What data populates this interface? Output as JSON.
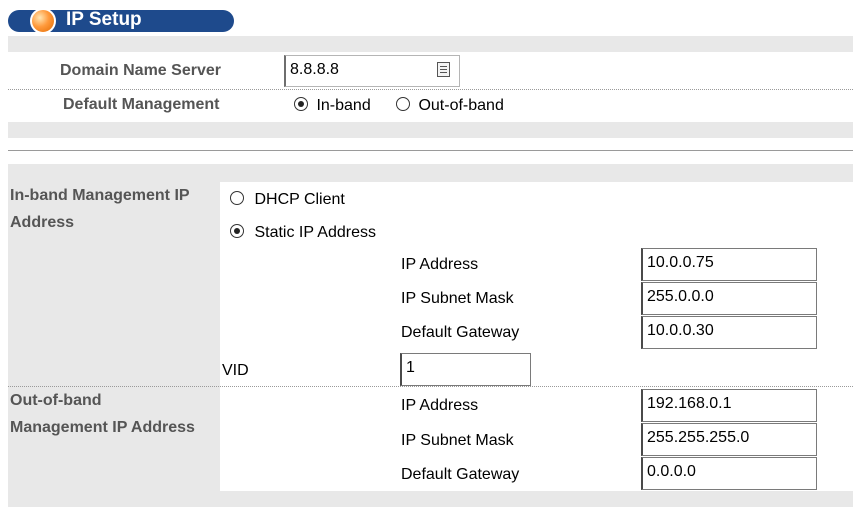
{
  "title": "IP Setup",
  "dns": {
    "label": "Domain Name Server",
    "value": "8.8.8.8",
    "picker_icon": "list-picker-icon"
  },
  "default_management": {
    "label": "Default Management",
    "options": [
      {
        "label": "In-band",
        "selected": true
      },
      {
        "label": "Out-of-band",
        "selected": false
      }
    ]
  },
  "inband": {
    "label_line1": "In-band Management IP",
    "label_line2": "Address",
    "dhcp_label": "DHCP Client",
    "dhcp_selected": false,
    "static_label": "Static IP Address",
    "static_selected": true,
    "ip_label": "IP Address",
    "ip_value": "10.0.0.75",
    "mask_label": "IP Subnet Mask",
    "mask_value": "255.0.0.0",
    "gw_label": "Default Gateway",
    "gw_value": "10.0.0.30",
    "vid_label": "VID",
    "vid_value": "1"
  },
  "outband": {
    "label_line1": "Out-of-band",
    "label_line2": "Management IP Address",
    "ip_label": "IP Address",
    "ip_value": "192.168.0.1",
    "mask_label": "IP Subnet Mask",
    "mask_value": "255.255.255.0",
    "gw_label": "Default Gateway",
    "gw_value": "0.0.0.0"
  },
  "colors": {
    "title_bar": "#1e4a8c",
    "panel_gray": "#e8e8e8",
    "label_gray": "#555555"
  }
}
